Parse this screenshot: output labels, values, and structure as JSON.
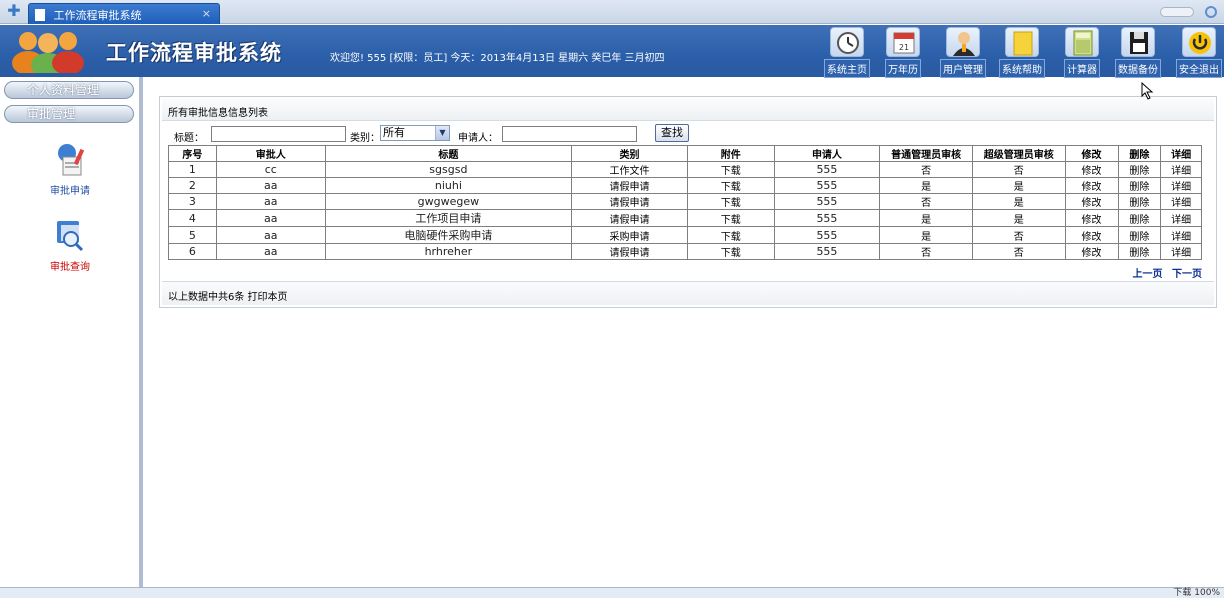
{
  "browser": {
    "tab_title": "工作流程审批系统",
    "tab_close": "×"
  },
  "header": {
    "title": "工作流程审批系统",
    "welcome": "欢迎您! 555 [权限：员工] 今天：2013年4月13日 星期六 癸巳年 三月初四"
  },
  "toolbar": [
    {
      "label": "系统主页",
      "icon": "clock-icon"
    },
    {
      "label": "万年历",
      "icon": "calendar-icon"
    },
    {
      "label": "用户管理",
      "icon": "user-icon"
    },
    {
      "label": "系统帮助",
      "icon": "help-book-icon"
    },
    {
      "label": "计算器",
      "icon": "calculator-icon"
    },
    {
      "label": "数据备份",
      "icon": "floppy-disk-icon"
    },
    {
      "label": "安全退出",
      "icon": "power-icon"
    }
  ],
  "sidebar": {
    "accordion": [
      "个人资料管理",
      "审批管理"
    ],
    "items": [
      {
        "label": "审批申请",
        "icon": "approval-request-icon"
      },
      {
        "label": "审批查询",
        "icon": "approval-query-icon"
      }
    ]
  },
  "main": {
    "panel_title": "所有审批信息信息列表",
    "search": {
      "title_label": "标题：",
      "category_label": "类别：",
      "category_value": "所有",
      "applicant_label": "申请人：",
      "search_button": "查找"
    },
    "table": {
      "headers": [
        "序号",
        "审批人",
        "标题",
        "类别",
        "附件",
        "申请人",
        "普通管理员审核",
        "超级管理员审核",
        "修改",
        "删除",
        "详细"
      ],
      "rows": [
        [
          "1",
          "cc",
          "sgsgsd",
          "工作文件",
          "下载",
          "555",
          "否",
          "否",
          "修改",
          "删除",
          "详细"
        ],
        [
          "2",
          "aa",
          "niuhi",
          "请假申请",
          "下载",
          "555",
          "是",
          "是",
          "修改",
          "删除",
          "详细"
        ],
        [
          "3",
          "aa",
          "gwgwegew",
          "请假申请",
          "下载",
          "555",
          "否",
          "是",
          "修改",
          "删除",
          "详细"
        ],
        [
          "4",
          "aa",
          "工作项目申请",
          "请假申请",
          "下载",
          "555",
          "是",
          "是",
          "修改",
          "删除",
          "详细"
        ],
        [
          "5",
          "aa",
          "电脑硬件采购申请",
          "采购申请",
          "下载",
          "555",
          "是",
          "否",
          "修改",
          "删除",
          "详细"
        ],
        [
          "6",
          "aa",
          "hrhreher",
          "请假申请",
          "下载",
          "555",
          "否",
          "否",
          "修改",
          "删除",
          "详细"
        ]
      ]
    },
    "pager": {
      "prev": "上一页",
      "next": "下一页"
    },
    "footer": "以上数据中共6条  打印本页"
  },
  "statusbar": {
    "text": "下载",
    "zoom": "100%"
  }
}
